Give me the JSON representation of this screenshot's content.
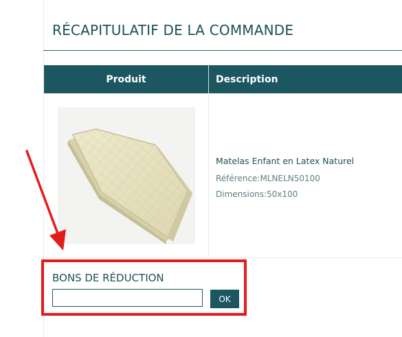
{
  "summary": {
    "title": "RÉCAPITULATIF DE LA COMMANDE"
  },
  "table": {
    "headers": [
      "Produit",
      "Description"
    ],
    "rows": [
      {
        "name": "Matelas Enfant en Latex Naturel",
        "reference": "Référence:MLNELN50100",
        "dimensions": "Dimensions:50x100"
      }
    ]
  },
  "coupon": {
    "title": "BONS DE RÉDUCTION",
    "input_value": "",
    "button_label": "OK"
  },
  "colors": {
    "accent": "#1c5660",
    "highlight": "#e41b1b"
  },
  "icons": {
    "annotation": "red-arrow-icon"
  }
}
